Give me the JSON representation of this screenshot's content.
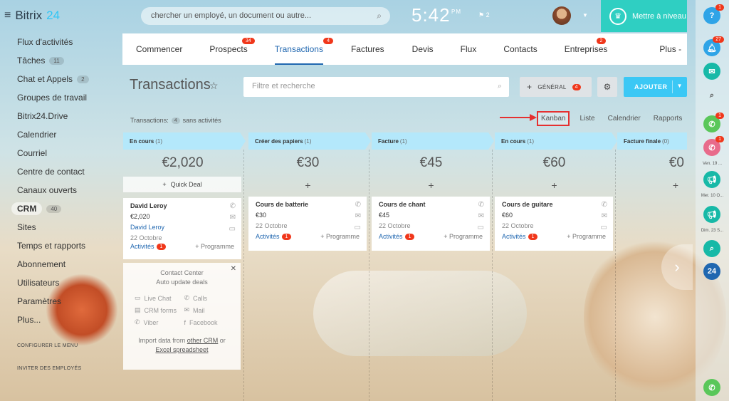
{
  "app": {
    "name": "Bitrix",
    "name_num": "24"
  },
  "sidebar": {
    "items": [
      {
        "label": "Flux d'activités",
        "count": ""
      },
      {
        "label": "Tâches",
        "count": "11"
      },
      {
        "label": "Chat et Appels",
        "count": "2"
      },
      {
        "label": "Groupes de travail",
        "count": ""
      },
      {
        "label": "Bitrix24.Drive",
        "count": ""
      },
      {
        "label": "Calendrier",
        "count": ""
      },
      {
        "label": "Courriel",
        "count": ""
      },
      {
        "label": "Centre de contact",
        "count": ""
      },
      {
        "label": "Canaux ouverts",
        "count": ""
      },
      {
        "label": "CRM",
        "count": "40",
        "active": true
      },
      {
        "label": "Sites",
        "count": ""
      },
      {
        "label": "Temps et rapports",
        "count": ""
      },
      {
        "label": "Abonnement",
        "count": ""
      },
      {
        "label": "Utilisateurs",
        "count": ""
      },
      {
        "label": "Paramètres",
        "count": ""
      },
      {
        "label": "Plus...",
        "count": ""
      }
    ],
    "configure_menu": "CONFIGURER LE MENU",
    "invite": "INVITER DES EMPLOYÉS"
  },
  "header": {
    "search_placeholder": "chercher un employé, un document ou autre...",
    "clock": "5:42",
    "clock_ampm": "PM",
    "flag_count": "2",
    "upgrade_label": "Mettre à niveau"
  },
  "tabs": [
    {
      "label": "Commencer",
      "badge": ""
    },
    {
      "label": "Prospects",
      "badge": "34"
    },
    {
      "label": "Transactions",
      "badge": "4",
      "active": true
    },
    {
      "label": "Factures",
      "badge": ""
    },
    {
      "label": "Devis",
      "badge": ""
    },
    {
      "label": "Flux",
      "badge": ""
    },
    {
      "label": "Contacts",
      "badge": ""
    },
    {
      "label": "Entreprises",
      "badge": "2"
    },
    {
      "label": "Plus -",
      "badge": ""
    }
  ],
  "page": {
    "title": "Transactions",
    "filter_placeholder": "Filtre et recherche",
    "general_label": "GÉNÉRAL",
    "general_badge": "4",
    "add_label": "AJOUTER",
    "summary_prefix": "Transactions:",
    "summary_count": "4",
    "summary_suffix": "sans activités",
    "views": [
      "Kanban",
      "Liste",
      "Calendrier",
      "Rapports"
    ]
  },
  "kanban": {
    "columns": [
      {
        "stage": "En cours",
        "count": "(1)",
        "amount": "€2,020",
        "color": "#b4e8fb"
      },
      {
        "stage": "Créer des papiers",
        "count": "(1)",
        "amount": "€30",
        "color": "#b4e8fb"
      },
      {
        "stage": "Facture",
        "count": "(1)",
        "amount": "€45",
        "color": "#b4e8fb"
      },
      {
        "stage": "En cours",
        "count": "(1)",
        "amount": "€60",
        "color": "#b4e8fb"
      },
      {
        "stage": "Facture finale",
        "count": "(0)",
        "amount": "€0",
        "color": "#b4e8fb"
      }
    ],
    "quick_deal": "Quick Deal",
    "plus": "+",
    "cards": [
      {
        "title": "David Leroy",
        "amount": "€2,020",
        "contact": "David Leroy",
        "date": "22 Octobre",
        "activities": "Activités",
        "act_badge": "1",
        "program": "+ Programme"
      },
      {
        "title": "Cours de batterie",
        "amount": "€30",
        "date": "22 Octobre",
        "activities": "Activités",
        "act_badge": "1",
        "program": "+ Programme"
      },
      {
        "title": "Cours de chant",
        "amount": "€45",
        "date": "22 Octobre",
        "activities": "Activités",
        "act_badge": "1",
        "program": "+ Programme"
      },
      {
        "title": "Cours de guitare",
        "amount": "€60",
        "date": "22 Octobre",
        "activities": "Activités",
        "act_badge": "1",
        "program": "+ Programme"
      }
    ]
  },
  "contact_center": {
    "title1": "Contact Center",
    "title2": "Auto update deals",
    "items": [
      "Live Chat",
      "Calls",
      "CRM forms",
      "Mail",
      "Viber",
      "Facebook"
    ],
    "import_prefix": "Import data from",
    "import_link1": "other CRM",
    "import_or": "or",
    "import_link2": "Excel spreadsheet"
  },
  "rightbar": {
    "help_badge": "1",
    "notif_badge": "27",
    "call1_badge": "1",
    "call2_badge": "1",
    "date1": "Ven. 19 ...",
    "date2": "Mer. 10 O...",
    "date3": "Dim. 23 S...",
    "b24": "24"
  },
  "colors": {
    "accent": "#2067b0",
    "add": "#3bc8f5",
    "upgrade": "#2fcfc2",
    "badge": "#f0371b",
    "stage": "#b4e8fb"
  }
}
